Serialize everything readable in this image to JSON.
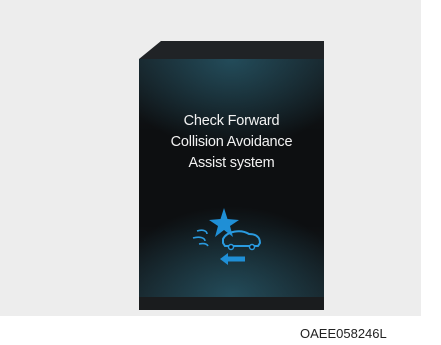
{
  "display": {
    "message_lines": [
      "Check Forward",
      "Collision Avoidance",
      "Assist system"
    ]
  },
  "graphic": {
    "icon": "collision-warning-icon",
    "accent_color": "#1f8fd6"
  },
  "image_code": "OAEE058246L"
}
